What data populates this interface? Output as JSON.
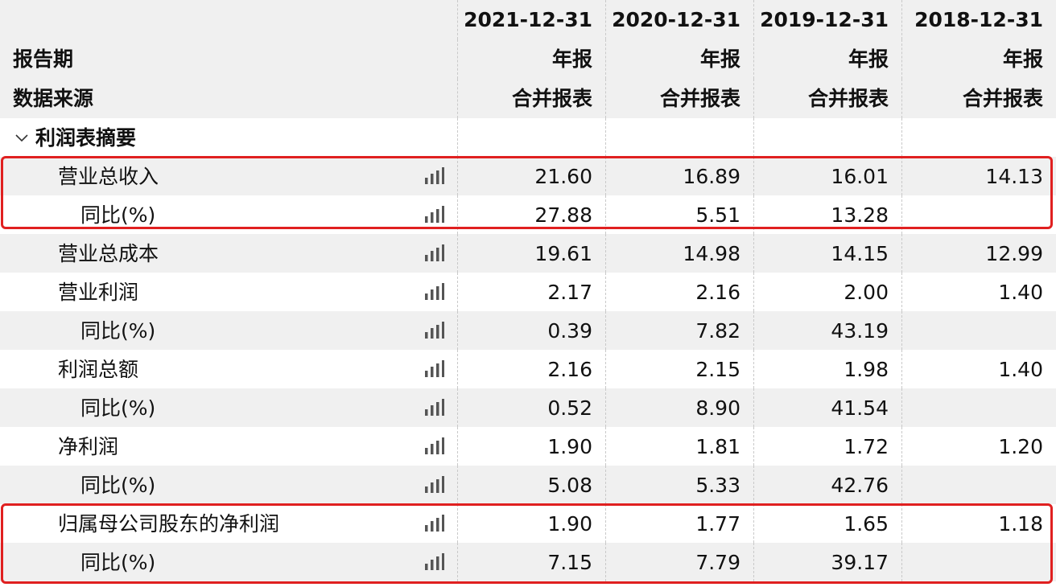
{
  "columns": [
    {
      "date": "2021-12-31",
      "type": "年报",
      "source": "合并报表"
    },
    {
      "date": "2020-12-31",
      "type": "年报",
      "source": "合并报表"
    },
    {
      "date": "2019-12-31",
      "type": "年报",
      "source": "合并报表"
    },
    {
      "date": "2018-12-31",
      "type": "年报",
      "source": "合并报表"
    }
  ],
  "header": {
    "period_label": "报告期",
    "source_label": "数据来源"
  },
  "section": {
    "title": "利润表摘要",
    "toggle_icon": "chevron-down-icon"
  },
  "rows": [
    {
      "label": "营业总收入",
      "level": 1,
      "values": [
        "21.60",
        "16.89",
        "16.01",
        "14.13"
      ]
    },
    {
      "label": "同比(%)",
      "level": 2,
      "values": [
        "27.88",
        "5.51",
        "13.28",
        ""
      ]
    },
    {
      "label": "营业总成本",
      "level": 1,
      "values": [
        "19.61",
        "14.98",
        "14.15",
        "12.99"
      ]
    },
    {
      "label": "营业利润",
      "level": 1,
      "values": [
        "2.17",
        "2.16",
        "2.00",
        "1.40"
      ]
    },
    {
      "label": "同比(%)",
      "level": 2,
      "values": [
        "0.39",
        "7.82",
        "43.19",
        ""
      ]
    },
    {
      "label": "利润总额",
      "level": 1,
      "values": [
        "2.16",
        "2.15",
        "1.98",
        "1.40"
      ]
    },
    {
      "label": "同比(%)",
      "level": 2,
      "values": [
        "0.52",
        "8.90",
        "41.54",
        ""
      ]
    },
    {
      "label": "净利润",
      "level": 1,
      "values": [
        "1.90",
        "1.81",
        "1.72",
        "1.20"
      ]
    },
    {
      "label": "同比(%)",
      "level": 2,
      "values": [
        "5.08",
        "5.33",
        "42.76",
        ""
      ]
    },
    {
      "label": "归属母公司股东的净利润",
      "level": 1,
      "values": [
        "1.90",
        "1.77",
        "1.65",
        "1.18"
      ]
    },
    {
      "label": "同比(%)",
      "level": 2,
      "values": [
        "7.15",
        "7.79",
        "39.17",
        ""
      ]
    }
  ],
  "row_chart_icon": "bar-chart-icon",
  "colors": {
    "highlight_border": "#e02020",
    "header_bg": "#f0f0f0",
    "stripe_bg": "#f0f0f0"
  }
}
